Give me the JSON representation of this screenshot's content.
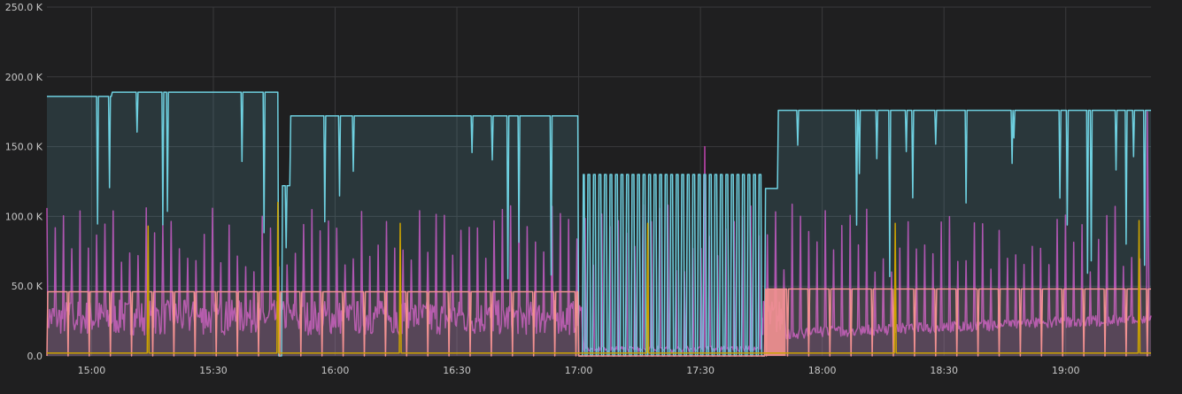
{
  "chart_data": {
    "type": "line",
    "title": "",
    "xlabel": "",
    "ylabel": "",
    "x_range": [
      "14:49",
      "19:21"
    ],
    "ylim": [
      0,
      250000
    ],
    "grid": true,
    "y_ticks": [
      {
        "value": 0,
        "label": "0.0"
      },
      {
        "value": 50000,
        "label": "50.0 K"
      },
      {
        "value": 100000,
        "label": "100.0 K"
      },
      {
        "value": 150000,
        "label": "150.0 K"
      },
      {
        "value": 200000,
        "label": "200.0 K"
      },
      {
        "value": 250000,
        "label": "250.0 K"
      }
    ],
    "x_ticks": [
      "15:00",
      "15:30",
      "16:00",
      "16:30",
      "17:00",
      "17:30",
      "18:00",
      "18:30",
      "19:00"
    ],
    "series": [
      {
        "color": "#6ed0e0",
        "area": true,
        "baseline_levels": [
          {
            "start": "14:49",
            "end": "15:05",
            "value": 186000
          },
          {
            "start": "15:05",
            "end": "15:46",
            "value": 189000
          },
          {
            "start": "15:47",
            "end": "15:49",
            "value": 122000
          },
          {
            "start": "15:49",
            "end": "17:00",
            "value": 172000
          },
          {
            "start": "17:01",
            "end": "17:45",
            "value": 130000,
            "pattern": "oscillating to 0"
          },
          {
            "start": "17:46",
            "end": "17:49",
            "value": 120000
          },
          {
            "start": "17:49",
            "end": "19:21",
            "value": 176000
          }
        ]
      },
      {
        "color": "#ba43a9",
        "area": true,
        "base_range": [
          15000,
          40000
        ],
        "spike_range": [
          60000,
          110000
        ],
        "notable_peaks": [
          {
            "x": "17:31",
            "value": 150000
          },
          {
            "x": "19:20",
            "value": 175000
          }
        ]
      },
      {
        "color": "#f29191",
        "area": true,
        "levels": [
          {
            "start": "14:49",
            "end": "17:00",
            "value": 46000
          },
          {
            "start": "17:01",
            "end": "17:45",
            "value": 0
          },
          {
            "start": "17:46",
            "end": "17:51",
            "value": 48000,
            "pattern": "filled block"
          },
          {
            "start": "17:51",
            "end": "19:21",
            "value": 48000
          }
        ]
      },
      {
        "color": "#cca300",
        "area": false,
        "base_value": 2000,
        "spikes": [
          {
            "x": "15:14",
            "value": 93000
          },
          {
            "x": "15:46",
            "value": 110000
          },
          {
            "x": "16:16",
            "value": 95000
          },
          {
            "x": "17:17",
            "value": 95000
          },
          {
            "x": "18:18",
            "value": 95000
          },
          {
            "x": "19:18",
            "value": 97000
          }
        ]
      }
    ]
  }
}
